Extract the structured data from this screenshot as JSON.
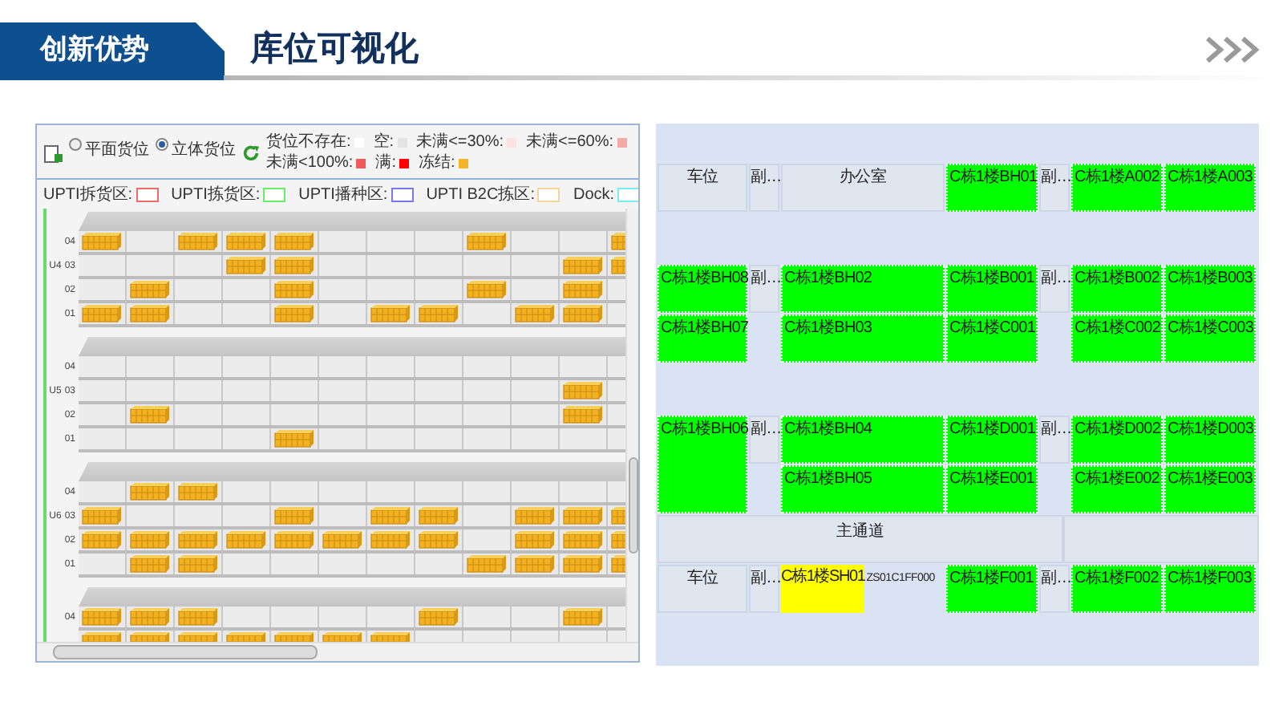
{
  "header": {
    "tag": "创新优势",
    "title": "库位可视化"
  },
  "rack_view": {
    "view_modes": [
      {
        "label": "平面货位",
        "selected": false
      },
      {
        "label": "立体货位",
        "selected": true
      }
    ],
    "status_legend": [
      {
        "label": "货位不存在:",
        "color": "#ffffff"
      },
      {
        "label": "空:",
        "color": "#e4e4e4"
      },
      {
        "label": "未满<=30%:",
        "color": "#fde2e2"
      },
      {
        "label": "未满<=60%:",
        "color": "#f6a9a9"
      },
      {
        "label": "未满<100%:",
        "color": "#ef5b5b"
      },
      {
        "label": "满:",
        "color": "#ff0000"
      },
      {
        "label": "冻结:",
        "color": "#f5b428"
      }
    ],
    "zone_legend": [
      {
        "label": "UPTI拆货区:",
        "color": "#f06a6a"
      },
      {
        "label": "UPTI拣货区:",
        "color": "#66ee66"
      },
      {
        "label": "UPTI播种区:",
        "color": "#7777ee"
      },
      {
        "label": "UPTI B2C拣区:",
        "color": "#f6d49a"
      },
      {
        "label": "Dock:",
        "color": "#77eeee"
      }
    ],
    "units": [
      {
        "label": "U4",
        "rows": [
          {
            "label": "04",
            "slots": [
              true,
              false,
              true,
              true,
              true,
              false,
              false,
              false,
              true,
              false,
              false,
              true
            ]
          },
          {
            "label": "03",
            "slots": [
              false,
              false,
              false,
              true,
              true,
              false,
              false,
              false,
              false,
              false,
              true,
              true
            ]
          },
          {
            "label": "02",
            "slots": [
              false,
              true,
              false,
              false,
              true,
              false,
              false,
              false,
              true,
              false,
              true,
              false
            ]
          },
          {
            "label": "01",
            "slots": [
              true,
              true,
              false,
              false,
              true,
              false,
              true,
              true,
              false,
              true,
              true,
              false
            ]
          }
        ]
      },
      {
        "label": "U5",
        "rows": [
          {
            "label": "04",
            "slots": [
              false,
              false,
              false,
              false,
              false,
              false,
              false,
              false,
              false,
              false,
              false,
              false
            ]
          },
          {
            "label": "03",
            "slots": [
              false,
              false,
              false,
              false,
              false,
              false,
              false,
              false,
              false,
              false,
              true,
              false
            ]
          },
          {
            "label": "02",
            "slots": [
              false,
              true,
              false,
              false,
              false,
              false,
              false,
              false,
              false,
              false,
              true,
              false
            ]
          },
          {
            "label": "01",
            "slots": [
              false,
              false,
              false,
              false,
              true,
              false,
              false,
              false,
              false,
              false,
              false,
              false
            ]
          }
        ]
      },
      {
        "label": "U6",
        "rows": [
          {
            "label": "04",
            "slots": [
              false,
              true,
              true,
              false,
              false,
              false,
              false,
              false,
              false,
              false,
              false,
              false
            ]
          },
          {
            "label": "03",
            "slots": [
              true,
              false,
              false,
              false,
              true,
              false,
              true,
              true,
              false,
              true,
              true,
              true
            ]
          },
          {
            "label": "02",
            "slots": [
              true,
              true,
              true,
              true,
              true,
              true,
              true,
              true,
              false,
              true,
              true,
              true
            ]
          },
          {
            "label": "01",
            "slots": [
              false,
              true,
              true,
              false,
              false,
              false,
              false,
              false,
              true,
              true,
              true,
              true
            ]
          }
        ]
      },
      {
        "rows": [
          {
            "label": "04",
            "slots": [
              true,
              true,
              true,
              false,
              false,
              false,
              false,
              true,
              false,
              false,
              true,
              false
            ]
          },
          {
            "slots": [
              true,
              true,
              true,
              true,
              true,
              true,
              true,
              false,
              false,
              false,
              false,
              false
            ]
          }
        ]
      }
    ]
  },
  "layout_map": {
    "rows": [
      {
        "kind": "cells",
        "cells": [
          {
            "kind": "label",
            "text": "车位"
          },
          {
            "kind": "aisle",
            "text": "副…"
          },
          {
            "kind": "label",
            "text": "办公室"
          },
          {
            "kind": "slot",
            "text": "C栋1楼BH01",
            "color": "#00ff00"
          },
          {
            "kind": "aisle",
            "text": "副…"
          },
          {
            "kind": "slot",
            "text": "C栋1楼A002",
            "color": "#00ff00"
          },
          {
            "kind": "slot",
            "text": "C栋1楼A003",
            "color": "#00ff00"
          }
        ]
      },
      {
        "kind": "gap"
      },
      {
        "kind": "cells",
        "cells": [
          {
            "kind": "slot",
            "text": "C栋1楼BH08",
            "color": "#00ff00"
          },
          {
            "kind": "aisle",
            "text": "副…"
          },
          {
            "kind": "slot",
            "text": "C栋1楼BH02",
            "color": "#00ff00"
          },
          {
            "kind": "slot",
            "text": "C栋1楼B001",
            "color": "#00ff00"
          },
          {
            "kind": "aisle",
            "text": "副…"
          },
          {
            "kind": "slot",
            "text": "C栋1楼B002",
            "color": "#00ff00"
          },
          {
            "kind": "slot",
            "text": "C栋1楼B003",
            "color": "#00ff00"
          }
        ]
      },
      {
        "kind": "cells",
        "cells": [
          {
            "kind": "slot",
            "text": "C栋1楼BH07",
            "color": "#00ff00"
          },
          {
            "kind": "empty"
          },
          {
            "kind": "slot",
            "text": "C栋1楼BH03",
            "color": "#00ff00"
          },
          {
            "kind": "slot",
            "text": "C栋1楼C001",
            "color": "#00ff00"
          },
          {
            "kind": "empty"
          },
          {
            "kind": "slot",
            "text": "C栋1楼C002",
            "color": "#00ff00"
          },
          {
            "kind": "slot",
            "text": "C栋1楼C003",
            "color": "#00ff00"
          }
        ]
      },
      {
        "kind": "gap"
      },
      {
        "kind": "cells",
        "cells": [
          {
            "kind": "slot",
            "text": "C栋1楼BH06",
            "color": "#00ff00",
            "tall": true
          },
          {
            "kind": "aisle",
            "text": "副…"
          },
          {
            "kind": "slot",
            "text": "C栋1楼BH04",
            "color": "#00ff00"
          },
          {
            "kind": "slot",
            "text": "C栋1楼D001",
            "color": "#00ff00"
          },
          {
            "kind": "aisle",
            "text": "副…"
          },
          {
            "kind": "slot",
            "text": "C栋1楼D002",
            "color": "#00ff00"
          },
          {
            "kind": "slot",
            "text": "C栋1楼D003",
            "color": "#00ff00"
          }
        ]
      },
      {
        "kind": "cells",
        "cells": [
          {
            "kind": "empty"
          },
          {
            "kind": "slot",
            "text": "C栋1楼BH05",
            "color": "#00ff00"
          },
          {
            "kind": "slot",
            "text": "C栋1楼E001",
            "color": "#00ff00"
          },
          {
            "kind": "empty"
          },
          {
            "kind": "slot",
            "text": "C栋1楼E002",
            "color": "#00ff00"
          },
          {
            "kind": "slot",
            "text": "C栋1楼E003",
            "color": "#00ff00"
          }
        ]
      },
      {
        "kind": "main_aisle",
        "text": "主通道"
      },
      {
        "kind": "cells",
        "cells": [
          {
            "kind": "label",
            "text": "车位"
          },
          {
            "kind": "aisle",
            "text": "副…"
          },
          {
            "kind": "split",
            "parts": [
              {
                "text": "C栋1楼SH01",
                "color": "#ffff00"
              },
              {
                "text": "ZS01C1FF000"
              }
            ]
          },
          {
            "kind": "slot",
            "text": "C栋1楼F001",
            "color": "#00ff00"
          },
          {
            "kind": "aisle",
            "text": "副…"
          },
          {
            "kind": "slot",
            "text": "C栋1楼F002",
            "color": "#00ff00"
          },
          {
            "kind": "slot",
            "text": "C栋1楼F003",
            "color": "#00ff00"
          }
        ]
      }
    ]
  }
}
